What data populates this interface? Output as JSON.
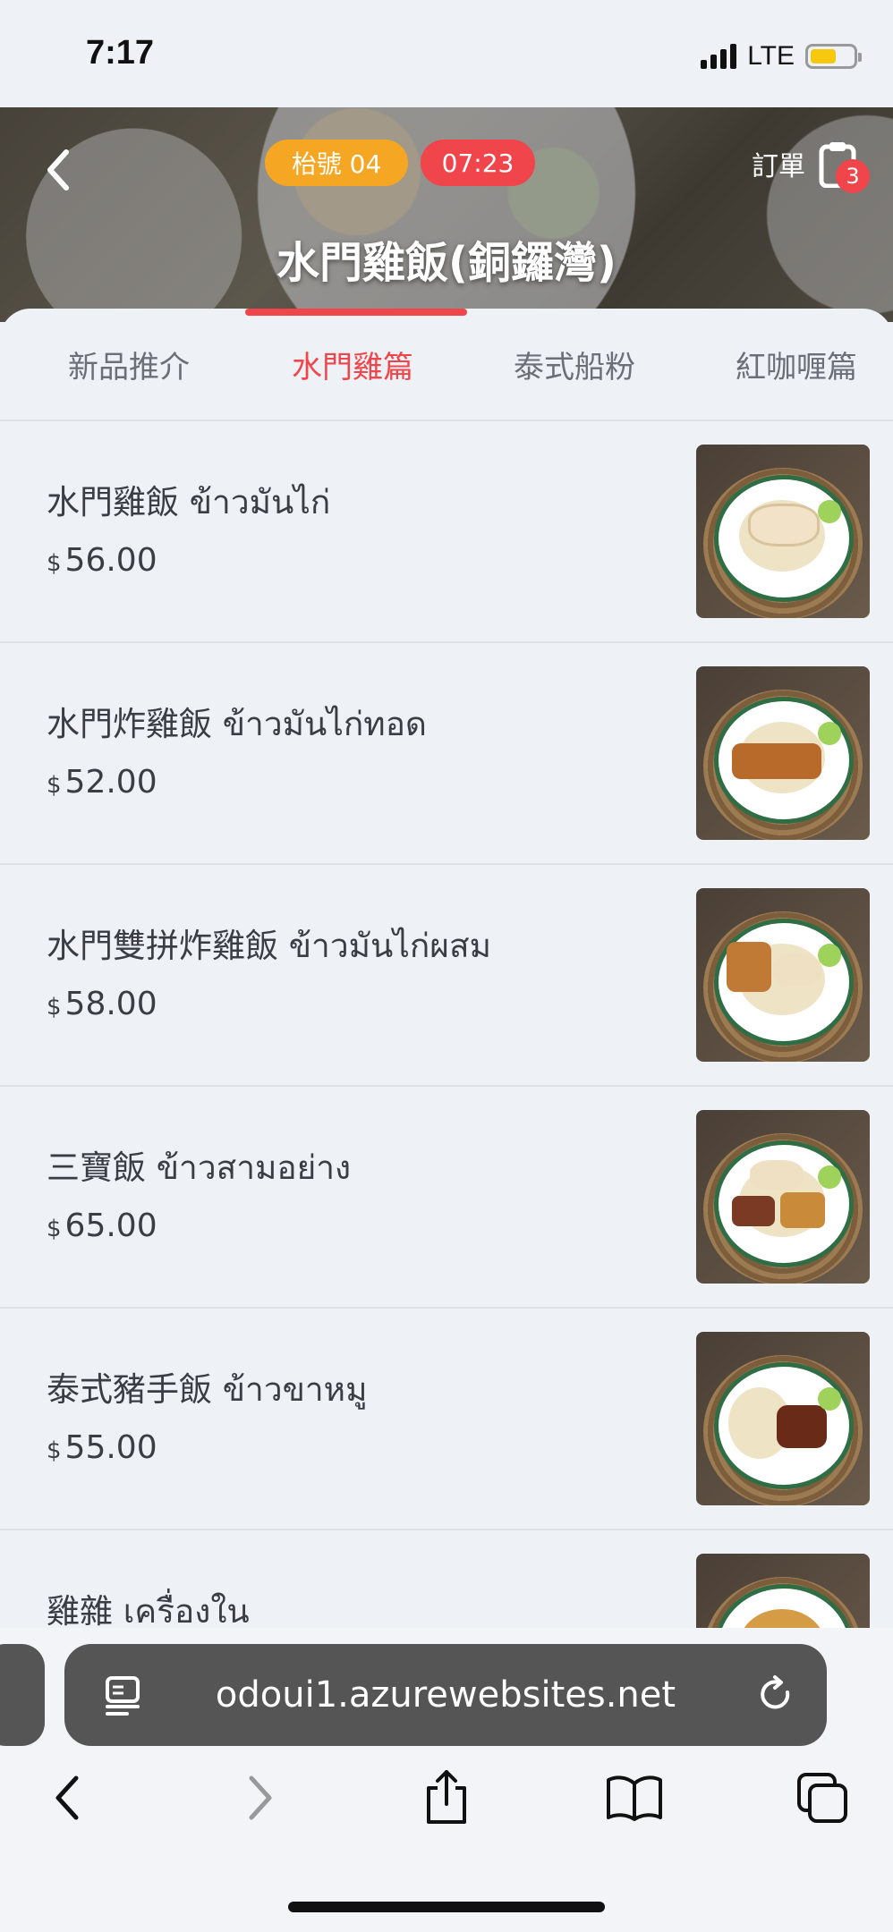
{
  "status_bar": {
    "time": "7:17",
    "network": "LTE"
  },
  "header": {
    "table_label": "枱號 04",
    "timer": "07:23",
    "orders_label": "訂單",
    "order_count": "3",
    "store_name": "水門雞飯(銅鑼灣)"
  },
  "tabs": [
    {
      "label": "新品推介",
      "active": false
    },
    {
      "label": "水門雞篇",
      "active": true
    },
    {
      "label": "泰式船粉",
      "active": false
    },
    {
      "label": "紅咖喱篇",
      "active": false
    }
  ],
  "menu_items": [
    {
      "name": "水門雞飯 ข้าวมันไก่",
      "currency": "$",
      "price": "56.00"
    },
    {
      "name": "水門炸雞飯 ข้าวมันไก่ทอด",
      "currency": "$",
      "price": "52.00"
    },
    {
      "name": "水門雙拼炸雞飯 ข้าวมันไก่ผสม",
      "currency": "$",
      "price": "58.00"
    },
    {
      "name": "三寶飯 ข้าวสามอย่าง",
      "currency": "$",
      "price": "65.00"
    },
    {
      "name": "泰式豬手飯 ข้าวขาหมู",
      "currency": "$",
      "price": "55.00"
    },
    {
      "name": "雞雜 เครื่องใน",
      "currency": "",
      "price": ""
    }
  ],
  "browser": {
    "url": "odoui1.azurewebsites.net"
  },
  "colors": {
    "accent": "#f0454a",
    "table_badge": "#f5a623",
    "background": "#eef1f6"
  }
}
